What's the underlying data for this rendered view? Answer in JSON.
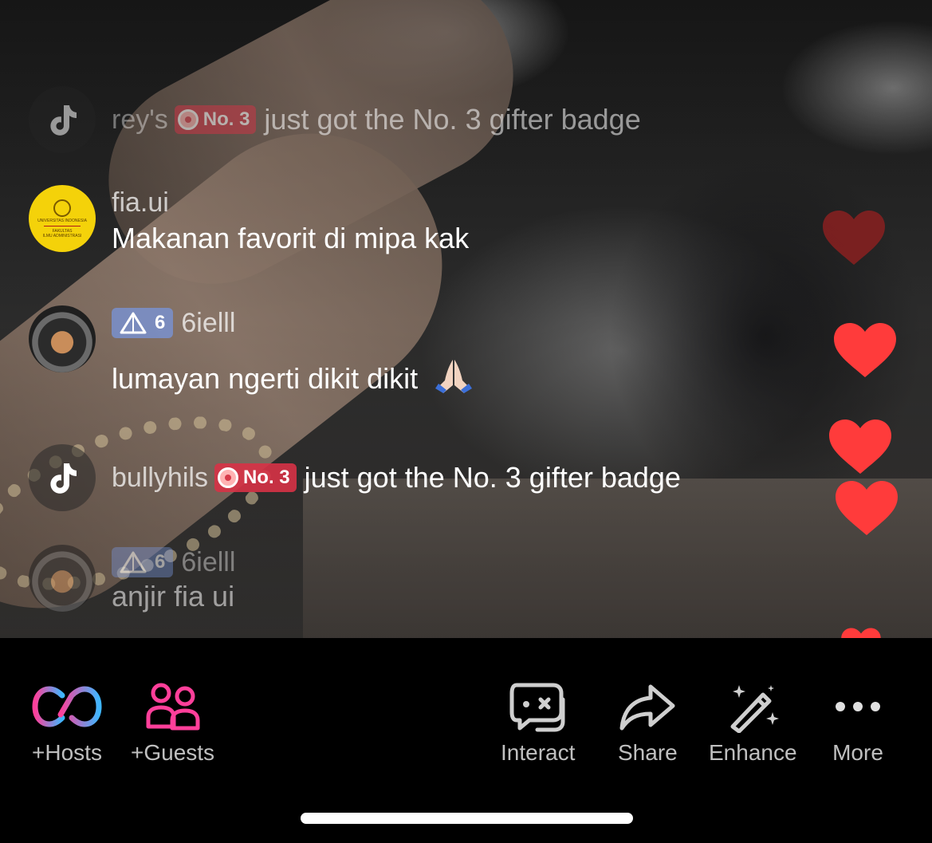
{
  "chat": {
    "system1": {
      "username": "rey's",
      "badge": "No. 3",
      "text": "just got the No. 3 gifter badge"
    },
    "comment1": {
      "username": "fia.ui",
      "message": "Makanan favorit di mipa kak",
      "avatar_text": [
        "UNIVERSITAS INDONESIA",
        "FAKULTAS",
        "ILMU ADMINISTRASI"
      ]
    },
    "comment2": {
      "level": "6",
      "username": "6ielll",
      "message": "lumayan ngerti dikit dikit"
    },
    "system2": {
      "username": "bullyhils",
      "badge": "No. 3",
      "text": "just got the No. 3 gifter badge"
    },
    "comment3": {
      "level": "6",
      "username": "6ielll",
      "message": "anjir fia ui"
    }
  },
  "colors": {
    "heart": "#ff3b3b",
    "heart_faded": "#8a2020",
    "badge_red": "#d73246",
    "badge_blue": "#7896dc",
    "hosts_gradient_start": "#ff3f9a",
    "hosts_gradient_end": "#3fb6ff",
    "guests": "#ff3f9a"
  },
  "toolbar": {
    "hosts_label": "+Hosts",
    "guests_label": "+Guests",
    "interact_label": "Interact",
    "share_label": "Share",
    "enhance_label": "Enhance",
    "more_label": "More",
    "icons": [
      "hosts-link-icon",
      "guests-icon",
      "interact-icon",
      "share-icon",
      "enhance-wand-icon",
      "more-icon"
    ]
  }
}
